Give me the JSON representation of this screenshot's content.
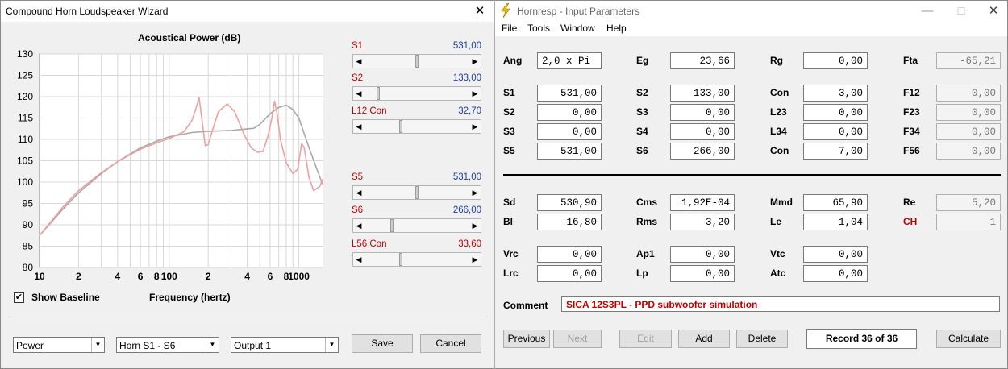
{
  "wizard": {
    "title": "Compound Horn Loudspeaker Wizard",
    "close_icon": "close-icon",
    "chart_data": {
      "type": "line",
      "title": "Acoustical Power (dB)",
      "xlabel": "Frequency (hertz)",
      "ylabel": "",
      "xscale": "log",
      "xlim": [
        10,
        2000
      ],
      "ylim": [
        80,
        130
      ],
      "yticks": [
        80,
        85,
        90,
        95,
        100,
        105,
        110,
        115,
        120,
        125,
        130
      ],
      "xtick_labels": [
        {
          "v": 10,
          "t": "10"
        },
        {
          "v": 20,
          "t": "2"
        },
        {
          "v": 40,
          "t": "4"
        },
        {
          "v": 60,
          "t": "6"
        },
        {
          "v": 80,
          "t": "8"
        },
        {
          "v": 100,
          "t": "100"
        },
        {
          "v": 200,
          "t": "2"
        },
        {
          "v": 400,
          "t": "4"
        },
        {
          "v": 600,
          "t": "6"
        },
        {
          "v": 800,
          "t": "8"
        },
        {
          "v": 1000,
          "t": "1000"
        },
        {
          "v": 2000,
          "t": "2"
        }
      ],
      "grid": true,
      "series": [
        {
          "color": "#a8a8a8",
          "points": [
            [
              10,
              87.5
            ],
            [
              15,
              93.5
            ],
            [
              20,
              97.5
            ],
            [
              30,
              102
            ],
            [
              40,
              104.8
            ],
            [
              60,
              108
            ],
            [
              80,
              109.6
            ],
            [
              100,
              110.6
            ],
            [
              150,
              111.6
            ],
            [
              200,
              111.9
            ],
            [
              300,
              112.1
            ],
            [
              450,
              112.6
            ],
            [
              500,
              113.5
            ],
            [
              600,
              116
            ],
            [
              700,
              117.5
            ],
            [
              800,
              118
            ],
            [
              900,
              117
            ],
            [
              1000,
              115
            ],
            [
              1200,
              108
            ],
            [
              1500,
              100
            ],
            [
              1800,
              95.5
            ],
            [
              2000,
              94.5
            ]
          ]
        },
        {
          "color": "#f0a0a0",
          "points": [
            [
              10,
              87.5
            ],
            [
              15,
              94
            ],
            [
              20,
              98
            ],
            [
              30,
              102.2
            ],
            [
              40,
              104.8
            ],
            [
              60,
              107.7
            ],
            [
              80,
              109.2
            ],
            [
              100,
              110.2
            ],
            [
              130,
              111.8
            ],
            [
              150,
              114.5
            ],
            [
              160,
              117
            ],
            [
              170,
              119.8
            ],
            [
              180,
              114
            ],
            [
              190,
              108.5
            ],
            [
              200,
              108.8
            ],
            [
              220,
              113
            ],
            [
              240,
              116.5
            ],
            [
              280,
              118.3
            ],
            [
              320,
              116.5
            ],
            [
              380,
              111
            ],
            [
              430,
              108
            ],
            [
              480,
              107
            ],
            [
              530,
              107.2
            ],
            [
              580,
              111
            ],
            [
              620,
              115
            ],
            [
              650,
              119
            ],
            [
              680,
              116
            ],
            [
              720,
              110
            ],
            [
              800,
              104.5
            ],
            [
              900,
              102
            ],
            [
              980,
              103
            ],
            [
              1050,
              109
            ],
            [
              1100,
              108
            ],
            [
              1200,
              101
            ],
            [
              1300,
              98
            ],
            [
              1450,
              99
            ],
            [
              1550,
              101
            ],
            [
              1650,
              99
            ],
            [
              1800,
              96
            ],
            [
              2000,
              94.5
            ]
          ]
        }
      ]
    },
    "show_baseline_label": "Show Baseline",
    "show_baseline_checked": "✔",
    "sliders": [
      {
        "name": "S1",
        "value": "531,00",
        "pos": 0.5,
        "color": "blue"
      },
      {
        "name": "S2",
        "value": "133,00",
        "pos": 0.12,
        "color": "blue"
      },
      {
        "name": "L12  Con",
        "value": "32,70",
        "pos": 0.34,
        "color": "blue"
      },
      {
        "name": "S5",
        "value": "531,00",
        "pos": 0.5,
        "color": "blue"
      },
      {
        "name": "S6",
        "value": "266,00",
        "pos": 0.25,
        "color": "blue"
      },
      {
        "name": "L56  Con",
        "value": "33,60",
        "pos": 0.34,
        "color": "red"
      }
    ],
    "dropdowns": [
      "Power",
      "Horn S1 - S6",
      "Output 1"
    ],
    "save_label": "Save",
    "cancel_label": "Cancel"
  },
  "hornresp": {
    "title": "Hornresp - Input Parameters",
    "menu": [
      "File",
      "Tools",
      "Window",
      "Help"
    ],
    "params": [
      {
        "label": "Ang",
        "value": "2,0 x Pi",
        "col": 0,
        "row": 0
      },
      {
        "label": "Eg",
        "value": "23,66",
        "col": 1,
        "row": 0
      },
      {
        "label": "Rg",
        "value": "0,00",
        "col": 2,
        "row": 0
      },
      {
        "label": "Fta",
        "value": "-65,21",
        "col": 3,
        "row": 0
      },
      {
        "label": "S1",
        "value": "531,00",
        "col": 0,
        "row": 1
      },
      {
        "label": "S2",
        "value": "133,00",
        "col": 1,
        "row": 1
      },
      {
        "label": "Con",
        "value": "3,00",
        "col": 2,
        "row": 1
      },
      {
        "label": "F12",
        "value": "0,00",
        "col": 3,
        "row": 1
      },
      {
        "label": "S2",
        "value": "0,00",
        "col": 0,
        "row": 2
      },
      {
        "label": "S3",
        "value": "0,00",
        "col": 1,
        "row": 2
      },
      {
        "label": "L23",
        "value": "0,00",
        "col": 2,
        "row": 2
      },
      {
        "label": "F23",
        "value": "0,00",
        "col": 3,
        "row": 2
      },
      {
        "label": "S3",
        "value": "0,00",
        "col": 0,
        "row": 3
      },
      {
        "label": "S4",
        "value": "0,00",
        "col": 1,
        "row": 3
      },
      {
        "label": "L34",
        "value": "0,00",
        "col": 2,
        "row": 3
      },
      {
        "label": "F34",
        "value": "0,00",
        "col": 3,
        "row": 3
      },
      {
        "label": "S5",
        "value": "531,00",
        "col": 0,
        "row": 4
      },
      {
        "label": "S6",
        "value": "266,00",
        "col": 1,
        "row": 4
      },
      {
        "label": "Con",
        "value": "7,00",
        "col": 2,
        "row": 4
      },
      {
        "label": "F56",
        "value": "0,00",
        "col": 3,
        "row": 4
      },
      {
        "label": "Sd",
        "value": "530,90",
        "col": 0,
        "row": 5
      },
      {
        "label": "Cms",
        "value": "1,92E-04",
        "col": 1,
        "row": 5
      },
      {
        "label": "Mmd",
        "value": "65,90",
        "col": 2,
        "row": 5
      },
      {
        "label": "Re",
        "value": "5,20",
        "col": 3,
        "row": 5
      },
      {
        "label": "Bl",
        "value": "16,80",
        "col": 0,
        "row": 6
      },
      {
        "label": "Rms",
        "value": "3,20",
        "col": 1,
        "row": 6
      },
      {
        "label": "Le",
        "value": "1,04",
        "col": 2,
        "row": 6
      },
      {
        "label": "CH",
        "value": "1",
        "col": 3,
        "row": 6
      },
      {
        "label": "Vrc",
        "value": "0,00",
        "col": 0,
        "row": 7
      },
      {
        "label": "Ap1",
        "value": "0,00",
        "col": 1,
        "row": 7
      },
      {
        "label": "Vtc",
        "value": "0,00",
        "col": 2,
        "row": 7
      },
      {
        "label": "Lrc",
        "value": "0,00",
        "col": 0,
        "row": 8
      },
      {
        "label": "Lp",
        "value": "0,00",
        "col": 1,
        "row": 8
      },
      {
        "label": "Atc",
        "value": "0,00",
        "col": 2,
        "row": 8
      }
    ],
    "comment_label": "Comment",
    "comment_value": "SICA 12S3PL - PPD subwoofer simulation",
    "buttons": {
      "previous": "Previous",
      "next": "Next",
      "edit": "Edit",
      "add": "Add",
      "delete": "Delete",
      "record": "Record 36 of 36",
      "calculate": "Calculate"
    },
    "colors": {
      "comment_text": "#c00000",
      "ch_label": "#c00000"
    }
  }
}
